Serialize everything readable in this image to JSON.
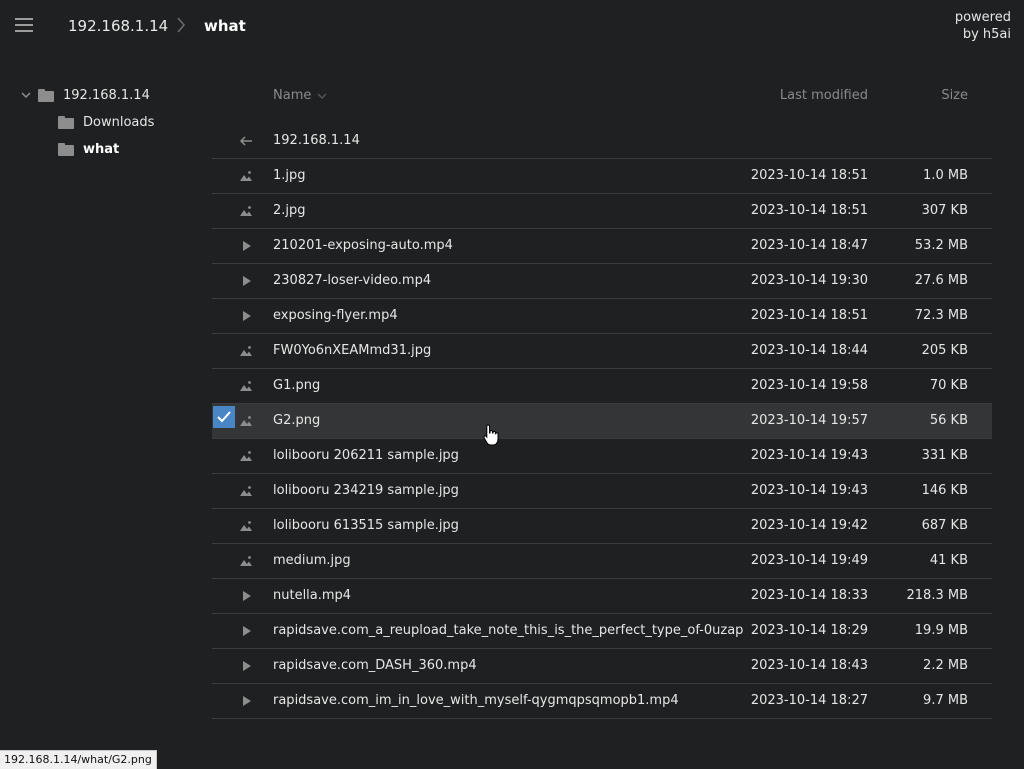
{
  "header": {
    "breadcrumb_root": "192.168.1.14",
    "breadcrumb_current": "what",
    "powered_line1": "powered",
    "powered_line2": "by h5ai"
  },
  "tree": {
    "root": "192.168.1.14",
    "children": [
      "Downloads",
      "what"
    ]
  },
  "columns": {
    "name": "Name",
    "modified": "Last modified",
    "size": "Size"
  },
  "parent_row": {
    "name": "192.168.1.14"
  },
  "files": [
    {
      "type": "image",
      "name": "1.jpg",
      "modified": "2023-10-14 18:51",
      "size": "1.0 MB"
    },
    {
      "type": "image",
      "name": "2.jpg",
      "modified": "2023-10-14 18:51",
      "size": "307 KB"
    },
    {
      "type": "video",
      "name": "210201-exposing-auto.mp4",
      "modified": "2023-10-14 18:47",
      "size": "53.2 MB"
    },
    {
      "type": "video",
      "name": "230827-loser-video.mp4",
      "modified": "2023-10-14 19:30",
      "size": "27.6 MB"
    },
    {
      "type": "video",
      "name": "exposing-flyer.mp4",
      "modified": "2023-10-14 18:51",
      "size": "72.3 MB"
    },
    {
      "type": "image",
      "name": "FW0Yo6nXEAMmd31.jpg",
      "modified": "2023-10-14 18:44",
      "size": "205 KB"
    },
    {
      "type": "image",
      "name": "G1.png",
      "modified": "2023-10-14 19:58",
      "size": "70 KB"
    },
    {
      "type": "image",
      "name": "G2.png",
      "modified": "2023-10-14 19:57",
      "size": "56 KB",
      "selected": true
    },
    {
      "type": "image",
      "name": "lolibooru 206211 sample.jpg",
      "modified": "2023-10-14 19:43",
      "size": "331 KB"
    },
    {
      "type": "image",
      "name": "lolibooru 234219 sample.jpg",
      "modified": "2023-10-14 19:43",
      "size": "146 KB"
    },
    {
      "type": "image",
      "name": "lolibooru 613515 sample.jpg",
      "modified": "2023-10-14 19:42",
      "size": "687 KB"
    },
    {
      "type": "image",
      "name": "medium.jpg",
      "modified": "2023-10-14 19:49",
      "size": "41 KB"
    },
    {
      "type": "video",
      "name": "nutella.mp4",
      "modified": "2023-10-14 18:33",
      "size": "218.3 MB"
    },
    {
      "type": "video",
      "name": "rapidsave.com_a_reupload_take_note_this_is_the_perfect_type_of-0uzap...",
      "modified": "2023-10-14 18:29",
      "size": "19.9 MB"
    },
    {
      "type": "video",
      "name": "rapidsave.com_DASH_360.mp4",
      "modified": "2023-10-14 18:43",
      "size": "2.2 MB"
    },
    {
      "type": "video",
      "name": "rapidsave.com_im_in_love_with_myself-qygmqpsqmopb1.mp4",
      "modified": "2023-10-14 18:27",
      "size": "9.7 MB"
    }
  ],
  "status_bar": "192.168.1.14/what/G2.png",
  "colors": {
    "background": "#1f2021",
    "selected_row": "#343536",
    "checkbox": "#4a86c5",
    "icon": "#8d8d8d"
  }
}
